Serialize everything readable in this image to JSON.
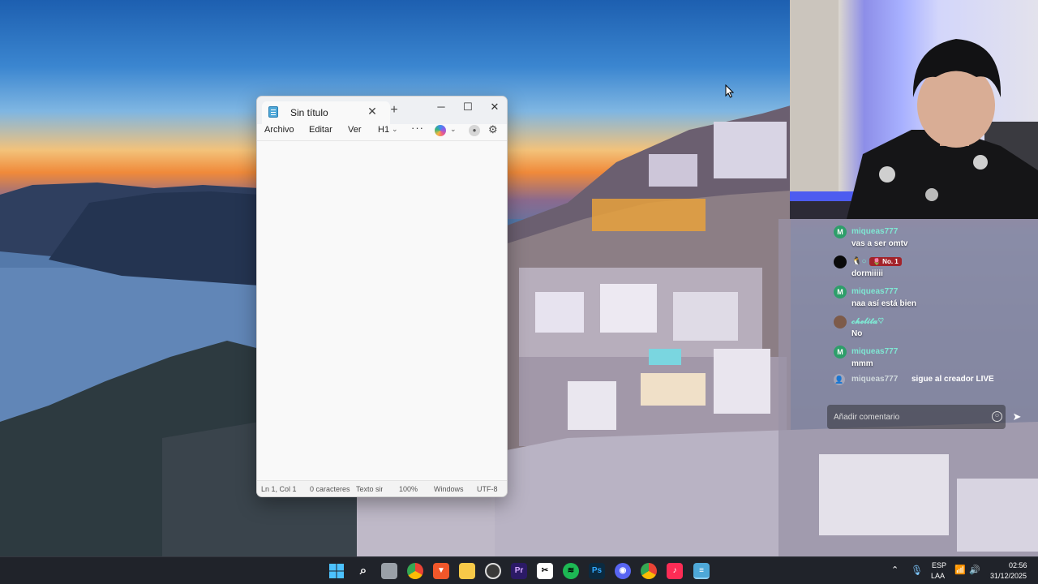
{
  "notepad": {
    "tab_title": "Sin título",
    "close_tab_glyph": "✕",
    "new_tab_glyph": "+",
    "controls": {
      "minimize": "─",
      "maximize": "☐",
      "close": "✕"
    },
    "menu": {
      "file": "Archivo",
      "edit": "Editar",
      "view": "Ver",
      "heading": "H1"
    },
    "text_content": "",
    "status": {
      "position": "Ln 1, Col 1",
      "chars": "0 caracteres",
      "format": "Texto sin formato",
      "zoom": "100%",
      "line_ending": "Windows",
      "encoding": "UTF-8"
    }
  },
  "chat": {
    "messages": [
      {
        "avatar_letter": "M",
        "avatar_color": "#2e9e6a",
        "user": "miqueas777",
        "text": "vas a ser omtv"
      },
      {
        "avatar_letter": "",
        "avatar_color": "#0a0a0a",
        "user": "🐧○",
        "badge": "🌷 No. 1",
        "text": "dormiiiii"
      },
      {
        "avatar_letter": "M",
        "avatar_color": "#2e9e6a",
        "user": "miqueas777",
        "text": "naa así está bien"
      },
      {
        "avatar_letter": "",
        "avatar_color": "#7d5b4a",
        "user": "𝓬𝓱𝓮𝓵𝓲𝓽𝓪♡",
        "text": "No"
      },
      {
        "avatar_letter": "M",
        "avatar_color": "#2e9e6a",
        "user": "miqueas777",
        "text": "mmm"
      }
    ],
    "follow": {
      "user": "miqueas777",
      "text": "sigue al creador LIVE"
    },
    "input_placeholder": "Añadir comentario"
  },
  "taskbar": {
    "apps": [
      "windows-start",
      "search",
      "file-manager",
      "chrome",
      "brave",
      "file-explorer",
      "obs",
      "premiere",
      "capcut",
      "spotify",
      "photoshop",
      "discord",
      "chrome",
      "tiktok-live",
      "notepad"
    ],
    "tray": {
      "lang_top": "ESP",
      "lang_bottom": "LAA",
      "time": "02:56",
      "date": "31/12/2025"
    }
  }
}
